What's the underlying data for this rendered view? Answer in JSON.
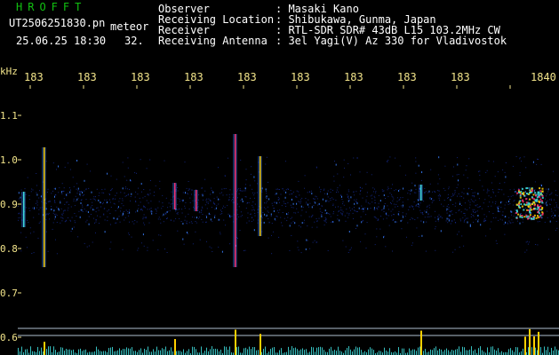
{
  "header": {
    "app_title": "HROFFT",
    "filename": "UT2506251830.pn",
    "mode": "meteor",
    "datetime": "25.06.25 18:30",
    "count": "32.",
    "info_labels": [
      "Observer",
      "Receiving Location",
      "Receiver",
      "Receiving Antenna"
    ],
    "info_values": [
      ": Masaki Kano",
      ": Shibukawa, Gunma, Japan",
      ": RTL-SDR SDR# 43dB L15 103.2MHz CW",
      ": 3el Yagi(V) Az 330 for Vladivostok"
    ]
  },
  "axes": {
    "y_unit": "kHz",
    "y_ticks": [
      "1.1",
      "1.0",
      "0.9",
      "0.8",
      "0.7",
      "0.6"
    ],
    "x_ticks": [
      "183",
      "183",
      "183",
      "183",
      "183",
      "183",
      "183",
      "183",
      "183",
      "1840"
    ]
  },
  "colors": {
    "background": "#000000",
    "header_text": "#ffffff",
    "app_title": "#11c011",
    "tick_text": "#f2e48a",
    "noise": "#1830a0",
    "noise_bright": "#3a7fff",
    "meteor_hot": "#ff3070",
    "meteor_warm": "#ffd000",
    "meteor_cyan": "#40e0e0",
    "baseline": "#b0c0d0"
  }
}
